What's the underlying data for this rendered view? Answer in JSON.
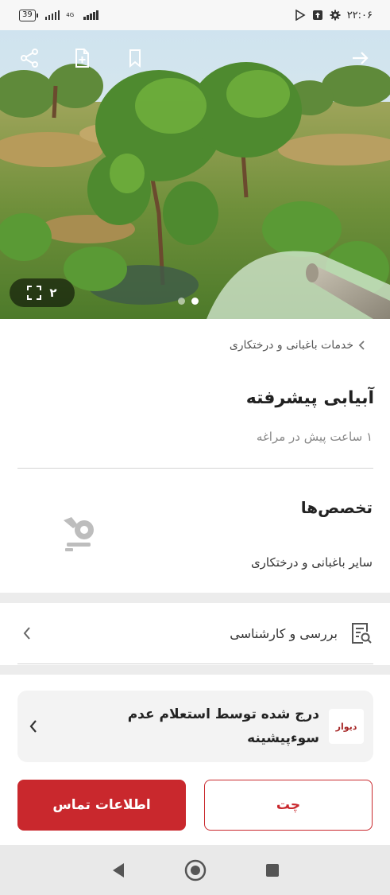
{
  "status_bar": {
    "battery": "39",
    "network": "4G",
    "time": "۲۲:۰۶"
  },
  "hero": {
    "photo_count": "۲",
    "icons": [
      "share-icon",
      "note-add-icon",
      "bookmark-icon",
      "back-arrow-icon"
    ]
  },
  "listing": {
    "breadcrumb": "خدمات باغبانی و درختکاری",
    "title": "آبیابی پیشرفته",
    "posted": "۱ ساعت پیش در مراغه",
    "specialty_heading": "تخصص‌ها",
    "specialty_value": "سایر باغبانی و درختکاری",
    "watermark": "شیپور"
  },
  "review": {
    "label": "بررسی و کارشناسی"
  },
  "alert": {
    "logo": "دیوار",
    "text": "درج شده توسط استعلام عدم سوء‌پیشینه"
  },
  "actions": {
    "chat": "چت",
    "contact": "اطلاعات تماس"
  },
  "colors": {
    "accent": "#c9282d",
    "band": "#ececec"
  }
}
